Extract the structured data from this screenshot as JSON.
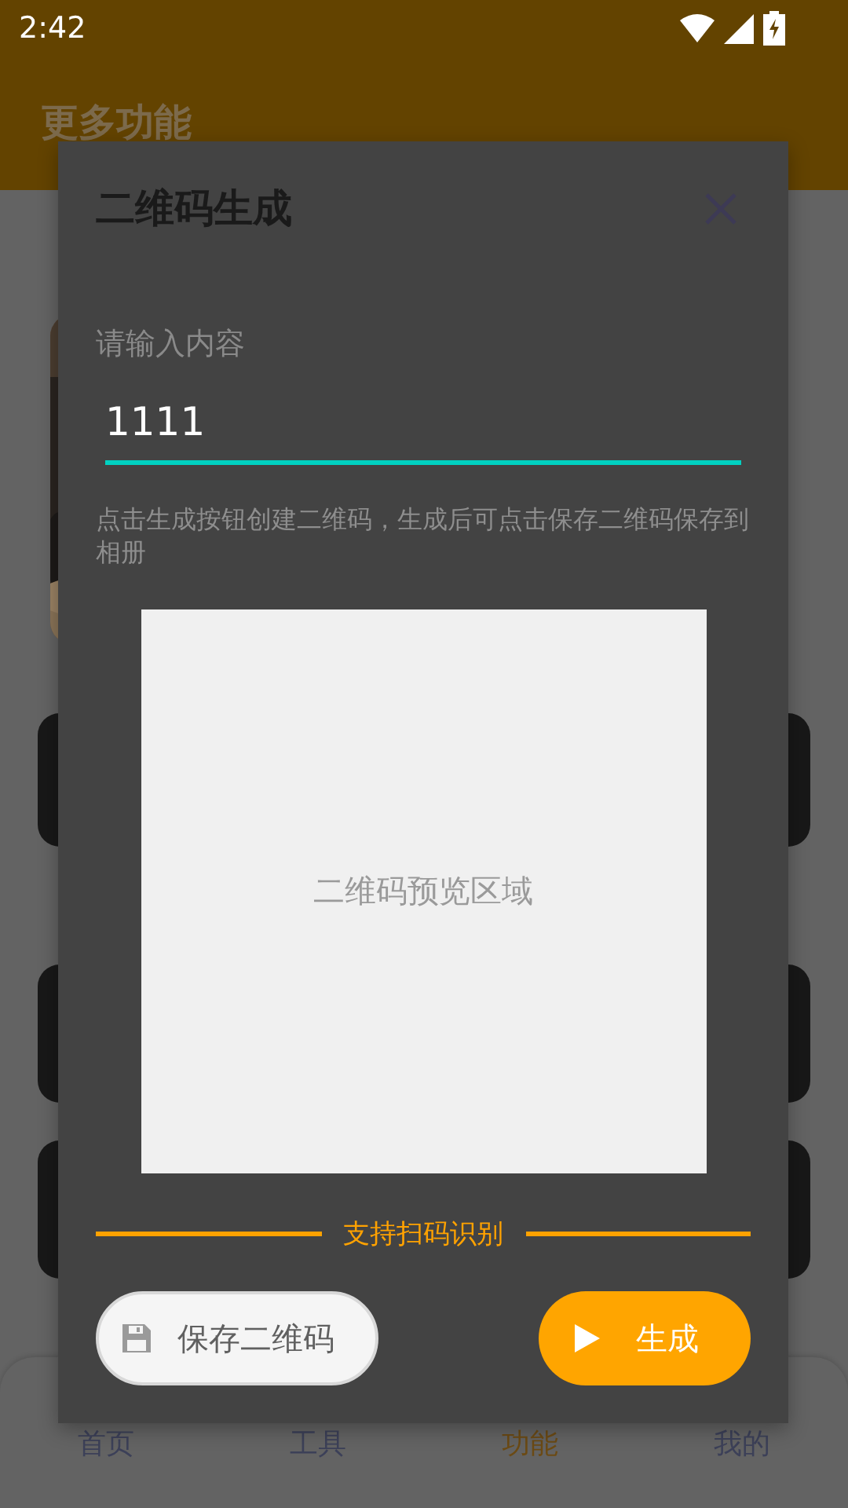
{
  "status_bar": {
    "time": "2:42"
  },
  "app": {
    "title": "更多功能",
    "sections": [
      {
        "cards": [
          {
            "kind": "picture"
          },
          {
            "kind": "tile"
          }
        ]
      },
      {
        "cards": [
          {
            "kind": "tile"
          },
          {
            "kind": "tile"
          }
        ]
      }
    ],
    "nav": [
      {
        "label": "首页",
        "selected": false
      },
      {
        "label": "工具",
        "selected": false
      },
      {
        "label": "功能",
        "selected": true
      },
      {
        "label": "我的",
        "selected": false
      }
    ]
  },
  "dialog": {
    "title": "二维码生成",
    "input": {
      "label": "请输入内容",
      "value": "1111"
    },
    "hint": "点击生成按钮创建二维码，生成后可点击保存二维码保存到相册",
    "preview_text": "二维码预览区域",
    "caption": "支持扫码识别",
    "buttons": [
      {
        "label": "保存二维码",
        "kind": "secondary"
      },
      {
        "label": "生成",
        "kind": "primary"
      }
    ]
  }
}
